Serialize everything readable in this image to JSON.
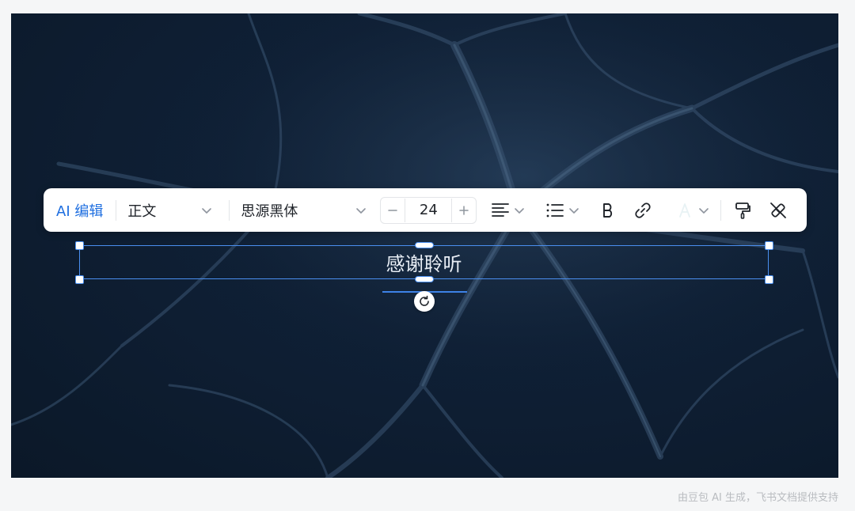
{
  "toolbar": {
    "ai_edit_label": "AI 编辑",
    "text_style": "正文",
    "font_family": "思源黑体",
    "font_size": "24",
    "decrease_icon": "minus-icon",
    "increase_icon": "plus-icon",
    "align_icon": "align-left-icon",
    "list_icon": "bullet-list-icon",
    "bold_icon": "bold-icon",
    "link_icon": "link-icon",
    "text_color_icon": "text-color-icon",
    "format_painter_icon": "format-painter-icon",
    "clear_format_icon": "clear-format-icon",
    "accent_color": "#1f6fe0"
  },
  "slide": {
    "text": "感谢聆听",
    "text_color": "#e8eef5",
    "background_color": "#0f2036"
  },
  "selection": {
    "border_color": "#4a8ff0",
    "rotate_icon": "rotate-icon"
  },
  "footer": {
    "note": "由豆包 AI 生成，飞书文档提供支持"
  }
}
